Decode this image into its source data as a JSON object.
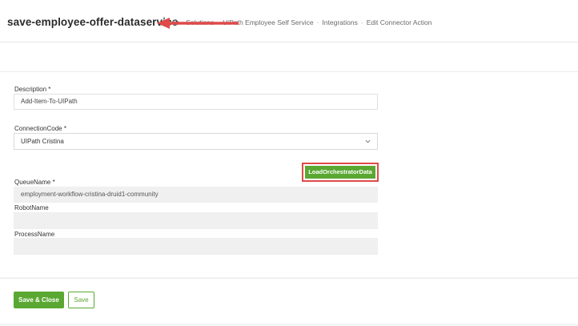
{
  "header": {
    "page_title": "save-employee-offer-dataservice",
    "breadcrumb": {
      "items": [
        "Solutions",
        "UiPath Employee Self Service",
        "Integrations",
        "Edit Connector Action"
      ],
      "separator": "·"
    }
  },
  "form": {
    "description": {
      "label": "Description *",
      "value": "Add-Item-To-UIPath"
    },
    "connection_code": {
      "label": "ConnectionCode *",
      "value": "UIPath Cristina"
    },
    "load_button_label": "LoadOrchestratorData",
    "queue_name": {
      "label": "QueueName *",
      "value": "employment-workflow-cristina-druid1-community"
    },
    "robot_name": {
      "label": "RobotName",
      "value": ""
    },
    "process_name": {
      "label": "ProcessName",
      "value": ""
    }
  },
  "footer": {
    "save_close_label": "Save & Close",
    "save_label": "Save"
  },
  "colors": {
    "accent_green": "#5aa832",
    "annotation_red": "#e04a4a"
  },
  "icons": [
    "home-icon",
    "chevron-down-icon"
  ]
}
